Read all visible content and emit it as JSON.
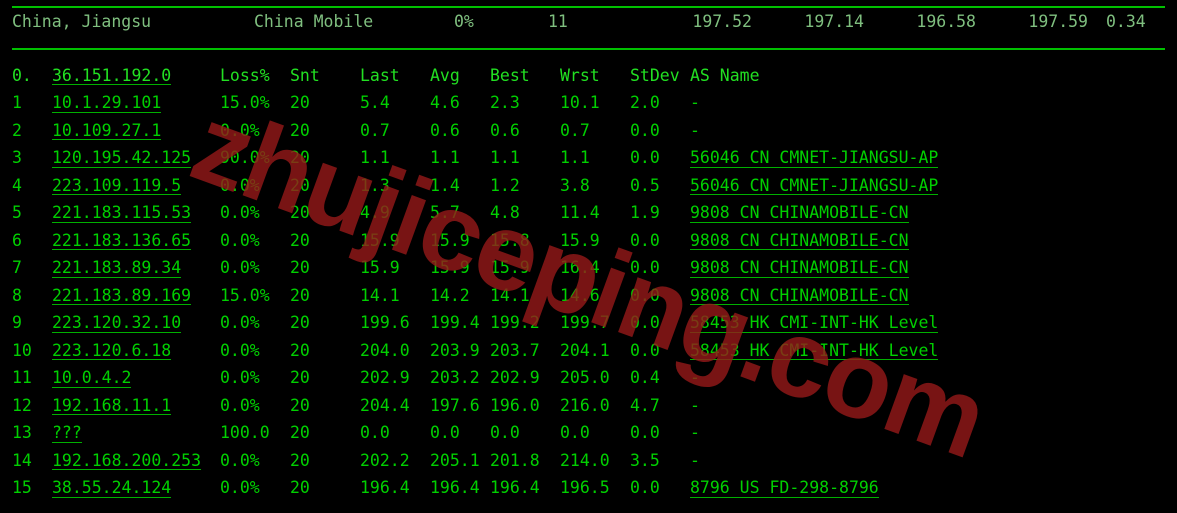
{
  "watermark": "zhujiceping.com",
  "summary": {
    "location": "China, Jiangsu",
    "carrier": "China Mobile",
    "loss_pct": "0%",
    "count": "11",
    "avg": "197.52",
    "best": "197.14",
    "wrst": "196.58",
    "last": "197.59",
    "stdev": "0.34"
  },
  "columns": {
    "hop": "0.",
    "target": "36.151.192.0",
    "loss": "Loss%",
    "snt": "Snt",
    "last": "Last",
    "avg": "Avg",
    "best": "Best",
    "wrst": "Wrst",
    "stdev": "StDev",
    "asname": "AS Name"
  },
  "hops": [
    {
      "n": "1",
      "host": "10.1.29.101",
      "loss": "15.0%",
      "snt": "20",
      "last": "5.4",
      "avg": "4.6",
      "best": "2.3",
      "wrst": "10.1",
      "stdev": "2.0",
      "asname": "-"
    },
    {
      "n": "2",
      "host": "10.109.27.1",
      "loss": "0.0%",
      "snt": "20",
      "last": "0.7",
      "avg": "0.6",
      "best": "0.6",
      "wrst": "0.7",
      "stdev": "0.0",
      "asname": "-"
    },
    {
      "n": "3",
      "host": "120.195.42.125",
      "loss": "90.0%",
      "snt": "20",
      "last": "1.1",
      "avg": "1.1",
      "best": "1.1",
      "wrst": "1.1",
      "stdev": "0.0",
      "asname": "56046 CN CMNET-JIANGSU-AP"
    },
    {
      "n": "4",
      "host": "223.109.119.5",
      "loss": "0.0%",
      "snt": "20",
      "last": "1.3",
      "avg": "1.4",
      "best": "1.2",
      "wrst": "3.8",
      "stdev": "0.5",
      "asname": "56046 CN CMNET-JIANGSU-AP"
    },
    {
      "n": "5",
      "host": "221.183.115.53",
      "loss": "0.0%",
      "snt": "20",
      "last": "4.9",
      "avg": "5.7",
      "best": "4.8",
      "wrst": "11.4",
      "stdev": "1.9",
      "asname": "9808  CN CHINAMOBILE-CN"
    },
    {
      "n": "6",
      "host": "221.183.136.65",
      "loss": "0.0%",
      "snt": "20",
      "last": "15.9",
      "avg": "15.9",
      "best": "15.8",
      "wrst": "15.9",
      "stdev": "0.0",
      "asname": "9808  CN CHINAMOBILE-CN"
    },
    {
      "n": "7",
      "host": "221.183.89.34",
      "loss": "0.0%",
      "snt": "20",
      "last": "15.9",
      "avg": "15.9",
      "best": "15.9",
      "wrst": "16.4",
      "stdev": "0.0",
      "asname": "9808  CN CHINAMOBILE-CN"
    },
    {
      "n": "8",
      "host": "221.183.89.169",
      "loss": "15.0%",
      "snt": "20",
      "last": "14.1",
      "avg": "14.2",
      "best": "14.1",
      "wrst": "14.6",
      "stdev": "0.0",
      "asname": "9808  CN CHINAMOBILE-CN"
    },
    {
      "n": "9",
      "host": "223.120.32.10",
      "loss": "0.0%",
      "snt": "20",
      "last": "199.6",
      "avg": "199.4",
      "best": "199.2",
      "wrst": "199.7",
      "stdev": "0.0",
      "asname": "58453 HK CMI-INT-HK Level"
    },
    {
      "n": "10",
      "host": "223.120.6.18",
      "loss": "0.0%",
      "snt": "20",
      "last": "204.0",
      "avg": "203.9",
      "best": "203.7",
      "wrst": "204.1",
      "stdev": "0.0",
      "asname": "58453 HK CMI-INT-HK Level"
    },
    {
      "n": "11",
      "host": "10.0.4.2",
      "loss": "0.0%",
      "snt": "20",
      "last": "202.9",
      "avg": "203.2",
      "best": "202.9",
      "wrst": "205.0",
      "stdev": "0.4",
      "asname": "-"
    },
    {
      "n": "12",
      "host": "192.168.11.1",
      "loss": "0.0%",
      "snt": "20",
      "last": "204.4",
      "avg": "197.6",
      "best": "196.0",
      "wrst": "216.0",
      "stdev": "4.7",
      "asname": "-"
    },
    {
      "n": "13",
      "host": "???",
      "loss": "100.0",
      "snt": "20",
      "last": "0.0",
      "avg": "0.0",
      "best": "0.0",
      "wrst": "0.0",
      "stdev": "0.0",
      "asname": "-"
    },
    {
      "n": "14",
      "host": "192.168.200.253",
      "loss": "0.0%",
      "snt": "20",
      "last": "202.2",
      "avg": "205.1",
      "best": "201.8",
      "wrst": "214.0",
      "stdev": "3.5",
      "asname": "-"
    },
    {
      "n": "15",
      "host": "38.55.24.124",
      "loss": "0.0%",
      "snt": "20",
      "last": "196.4",
      "avg": "196.4",
      "best": "196.4",
      "wrst": "196.5",
      "stdev": "0.0",
      "asname": "8796  US FD-298-8796"
    }
  ]
}
